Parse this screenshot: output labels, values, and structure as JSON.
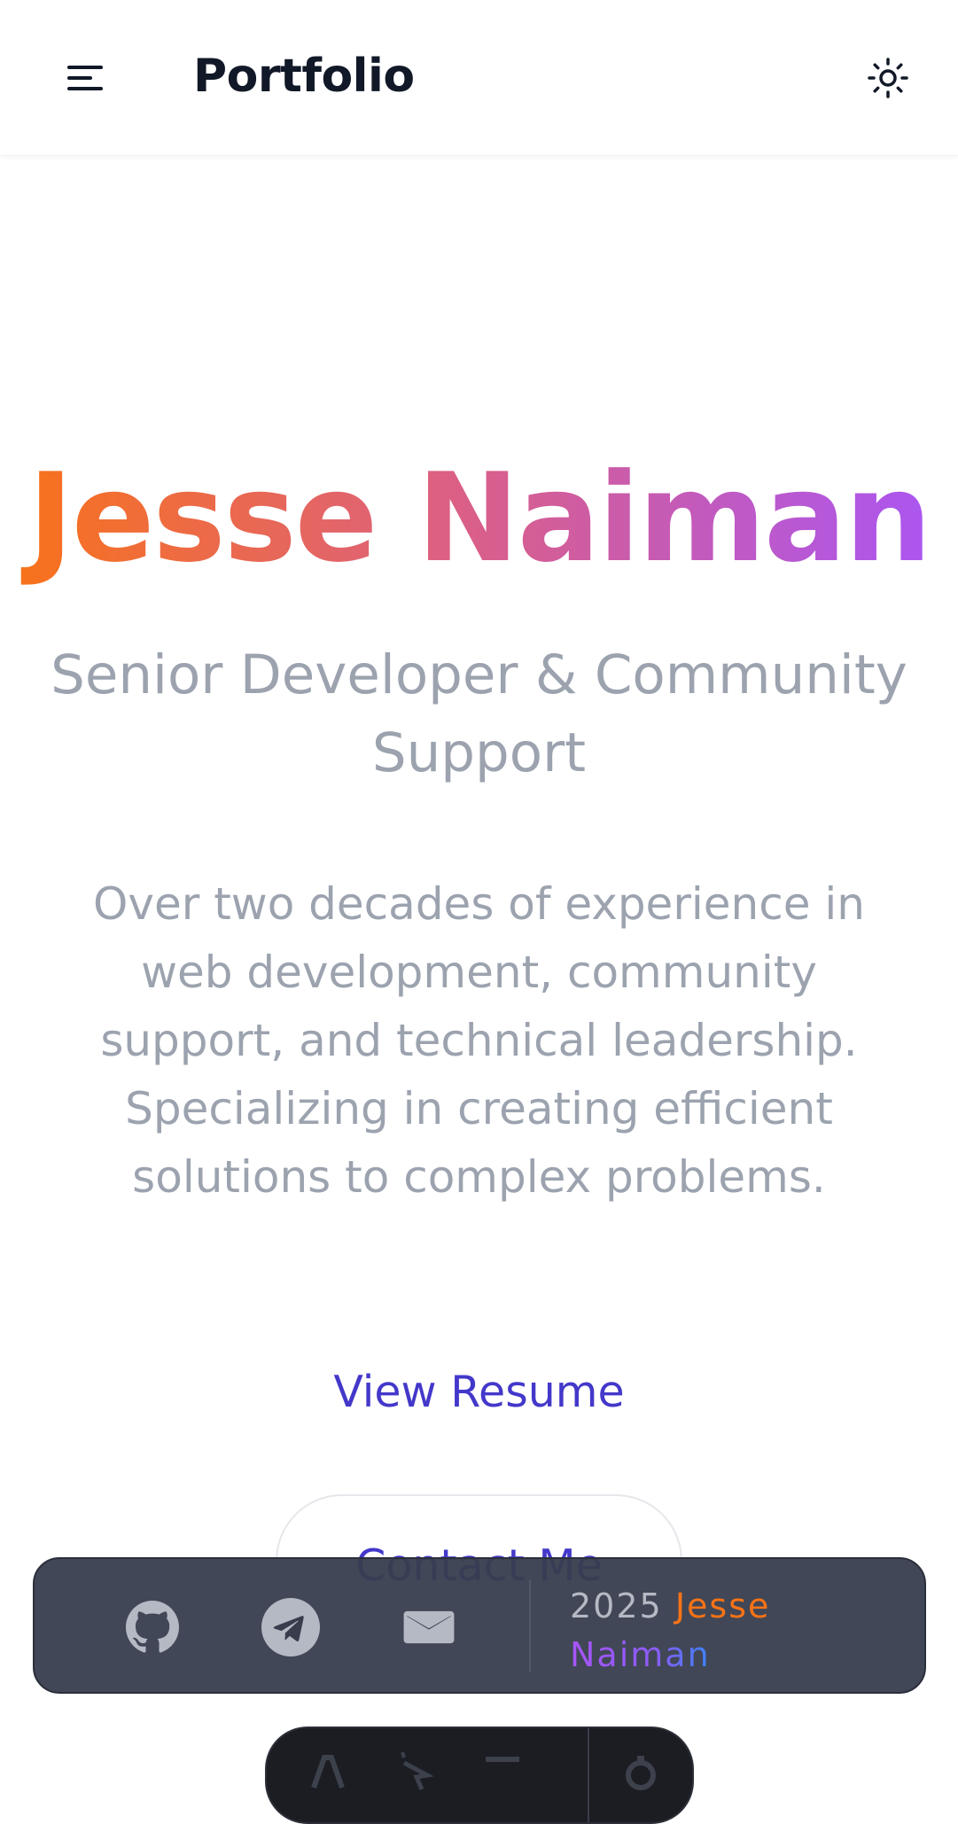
{
  "header": {
    "brand": "Portfolio",
    "menu_icon": "menu-icon",
    "theme_icon": "sun-icon"
  },
  "hero": {
    "name": "Jesse Naiman",
    "subtitle": "Senior Developer & Community Support",
    "bio": "Over two decades of experience in web development, community support, and technical leadership. Specializing in creating efficient solutions to complex problems."
  },
  "actions": {
    "resume_label": "View Resume",
    "contact_label": "Contact Me"
  },
  "footer": {
    "socials": [
      {
        "icon": "github-icon"
      },
      {
        "icon": "telegram-icon"
      },
      {
        "icon": "mail-icon"
      }
    ],
    "year": "2025",
    "name_first": "Jesse",
    "name_last": "Naiman"
  },
  "dock": {
    "items": [
      {
        "icon": "text-size-icon"
      },
      {
        "icon": "cursor-click-icon"
      },
      {
        "icon": "minus-icon"
      },
      {
        "icon": "gear-icon"
      }
    ]
  },
  "colors": {
    "accent": "#4338ca",
    "gradient_start": "#f97316",
    "gradient_mid": "#db5f86",
    "gradient_end": "#a855f7",
    "muted_text": "#9ca3af",
    "footer_bg": "#373d4d"
  }
}
